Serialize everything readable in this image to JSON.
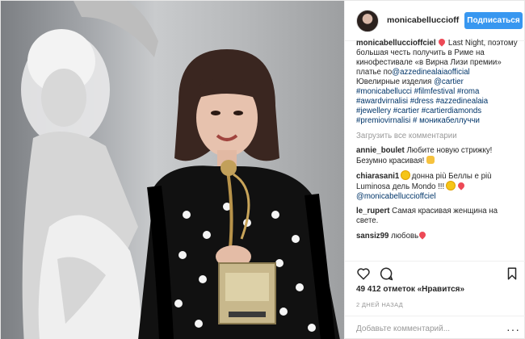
{
  "header": {
    "username": "monicabelluccioff",
    "follow_label": "Подписаться"
  },
  "caption": {
    "user": "monicabelluccioffciel",
    "text_1": " Last Night, поэтому большая честь получить в Риме на кинофестивале «в Вирна Лизи премии»",
    "text_2": "платье по",
    "mention_1": "@azzedinealaiaofficial",
    "text_3": "Ювелирные изделия ",
    "mention_2": "@cartier",
    "hashtags": "#monicabellucci #filmfestival #roma #awardvirnalisi #dress #azzedinealaia #jewellery #cartier #cartierdiamonds #premiovirnalisi # моникабеллуччи"
  },
  "load_more": "Загрузить все комментарии",
  "comments": [
    {
      "user": "annie_boulet",
      "text": "Любите новую стрижку! Безумно красивая! "
    },
    {
      "user": "chiarasani1",
      "text_a": " донна più Беллы e più Luminosa дель Mondo !!! ",
      "mention": "@monicabelluccioffciel"
    },
    {
      "user": "le_rupert",
      "text": "Самая красивая женщина на свете."
    },
    {
      "user": "sansiz99",
      "text": "любовь"
    }
  ],
  "likes": "49 412 отметок «Нравится»",
  "time": "2 ДНЕЙ НАЗАД",
  "add_comment_placeholder": "Добавьте комментарий...",
  "more_label": "···",
  "icons": {
    "like": "heart-icon",
    "comment": "comment-icon",
    "save": "bookmark-icon",
    "more": "more-options-icon"
  },
  "colors": {
    "follow_button": "#3897f0",
    "link": "#003569",
    "muted": "#999999"
  }
}
